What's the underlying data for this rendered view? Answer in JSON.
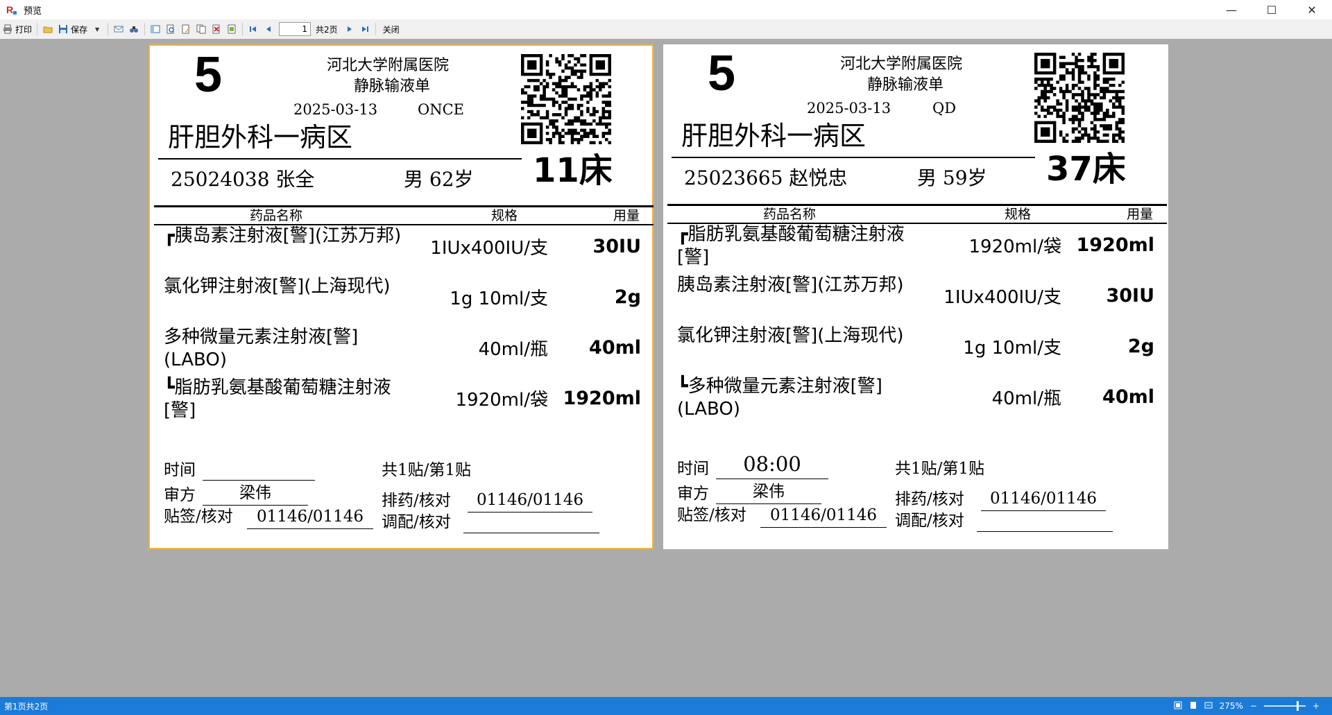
{
  "window": {
    "title": "预览",
    "minimize": "—",
    "maximize": "☐",
    "close": "✕"
  },
  "toolbar": {
    "print": "打印",
    "save": "保存",
    "page_value": "1",
    "page_total": "共2页",
    "close": "关闭"
  },
  "pages": [
    {
      "seq": "5",
      "hospital": "河北大学附属医院",
      "form_title": "静脉输液单",
      "date": "2025-03-13",
      "frequency": "ONCE",
      "department": "肝胆外科一病区",
      "patient_id_name": "25024038 张全",
      "sex_age": "男  62岁",
      "bed": "11床",
      "columns": {
        "name": "药品名称",
        "spec": "规格",
        "dose": "用量"
      },
      "drugs": [
        {
          "name": "┏胰岛素注射液[警](江苏万邦)",
          "spec": "1IUx400IU/支",
          "dose": "30IU"
        },
        {
          "name": "氯化钾注射液[警](上海现代)",
          "spec": "1g  10ml/支",
          "dose": "2g"
        },
        {
          "name": "多种微量元素注射液[警](LABO)",
          "spec": "40ml/瓶",
          "dose": "40ml"
        },
        {
          "name": "┗脂肪乳氨基酸葡萄糖注射液[警]",
          "spec": "1920ml/袋",
          "dose": "1920ml"
        }
      ],
      "footer": {
        "time_label": "时间",
        "time_value": "",
        "review_label": "审方",
        "review_value": "梁伟",
        "label_check_label": "贴签/核对",
        "label_check_value": "01146/01146",
        "count": "共1贴/第1贴",
        "dispense_label": "排药/核对",
        "dispense_value": "01146/01146",
        "mix_label": "调配/核对",
        "mix_value": ""
      }
    },
    {
      "seq": "5",
      "hospital": "河北大学附属医院",
      "form_title": "静脉输液单",
      "date": "2025-03-13",
      "frequency": "QD",
      "department": "肝胆外科一病区",
      "patient_id_name": "25023665 赵悦忠",
      "sex_age": "男  59岁",
      "bed": "37床",
      "columns": {
        "name": "药品名称",
        "spec": "规格",
        "dose": "用量"
      },
      "drugs": [
        {
          "name": "┏脂肪乳氨基酸葡萄糖注射液[警]",
          "spec": "1920ml/袋",
          "dose": "1920ml"
        },
        {
          "name": "胰岛素注射液[警](江苏万邦)",
          "spec": "1IUx400IU/支",
          "dose": "30IU"
        },
        {
          "name": "氯化钾注射液[警](上海现代)",
          "spec": "1g  10ml/支",
          "dose": "2g"
        },
        {
          "name": "┗多种微量元素注射液[警](LABO)",
          "spec": "40ml/瓶",
          "dose": "40ml"
        }
      ],
      "footer": {
        "time_label": "时间",
        "time_value": "08:00",
        "review_label": "审方",
        "review_value": "梁伟",
        "label_check_label": "贴签/核对",
        "label_check_value": "01146/01146",
        "count": "共1贴/第1贴",
        "dispense_label": "排药/核对",
        "dispense_value": "01146/01146",
        "mix_label": "调配/核对",
        "mix_value": ""
      }
    }
  ],
  "status": {
    "text": "第1页共2页",
    "zoom": "275%",
    "zoom_minus": "−",
    "zoom_plus": "+"
  }
}
